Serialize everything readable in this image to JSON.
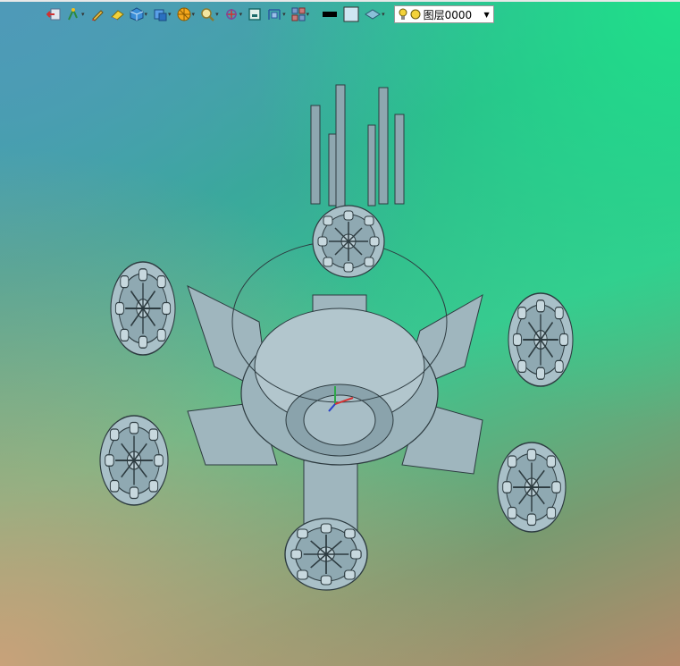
{
  "toolbar": {
    "tools": [
      {
        "icon": "exit-icon"
      },
      {
        "icon": "snap-icon"
      },
      {
        "icon": "pen-icon"
      },
      {
        "icon": "eraser-icon"
      },
      {
        "icon": "cube-icon"
      },
      {
        "icon": "view-cube-icon"
      },
      {
        "icon": "render-mode-icon"
      },
      {
        "icon": "zoom-icon"
      },
      {
        "icon": "rotate-icon"
      },
      {
        "icon": "frame-icon"
      },
      {
        "icon": "dimension-icon"
      },
      {
        "icon": "grid-icon"
      }
    ],
    "line_color": "#000000",
    "fill_color": "#cfe6f2",
    "layer": {
      "name": "图层0000",
      "light_color": "#f3d23a"
    }
  },
  "viewport": {
    "gradient_colors": [
      "#4e9ab8",
      "#1fe08a",
      "#c8a27a",
      "#6a8a60"
    ]
  }
}
